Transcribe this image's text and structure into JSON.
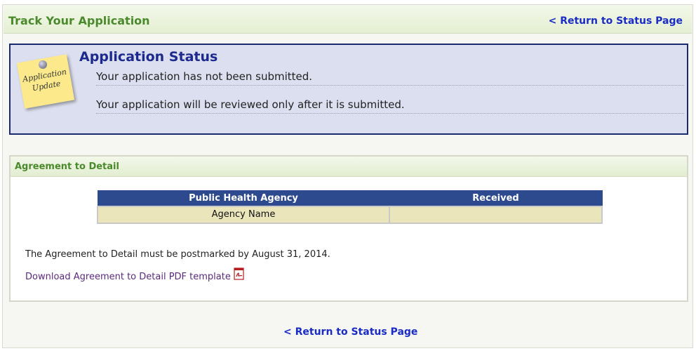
{
  "header": {
    "title": "Track Your Application",
    "return_link": "< Return to Status Page"
  },
  "status": {
    "note_line1": "Application",
    "note_line2": "Update",
    "title": "Application Status",
    "line1": "Your application has not been submitted.",
    "line2": "Your application will be reviewed only after it is submitted."
  },
  "agreement": {
    "title": "Agreement to Detail",
    "table": {
      "columns": [
        "Public Health Agency",
        "Received"
      ],
      "rows": [
        [
          "Agency Name",
          ""
        ]
      ]
    },
    "postmark_text": "The Agreement to Detail must be postmarked by August 31, 2014.",
    "download_link": "Download Agreement to Detail PDF template"
  },
  "footer": {
    "return_link": "< Return to Status Page"
  },
  "icons": {
    "note": "sticky-note-icon",
    "pdf": "pdf-icon"
  },
  "colors": {
    "header_green": "#4a8a2c",
    "link_blue": "#1a2cc4",
    "status_title": "#1b2a8c",
    "table_header": "#2d4a8e",
    "download_link": "#5a2a7a"
  }
}
